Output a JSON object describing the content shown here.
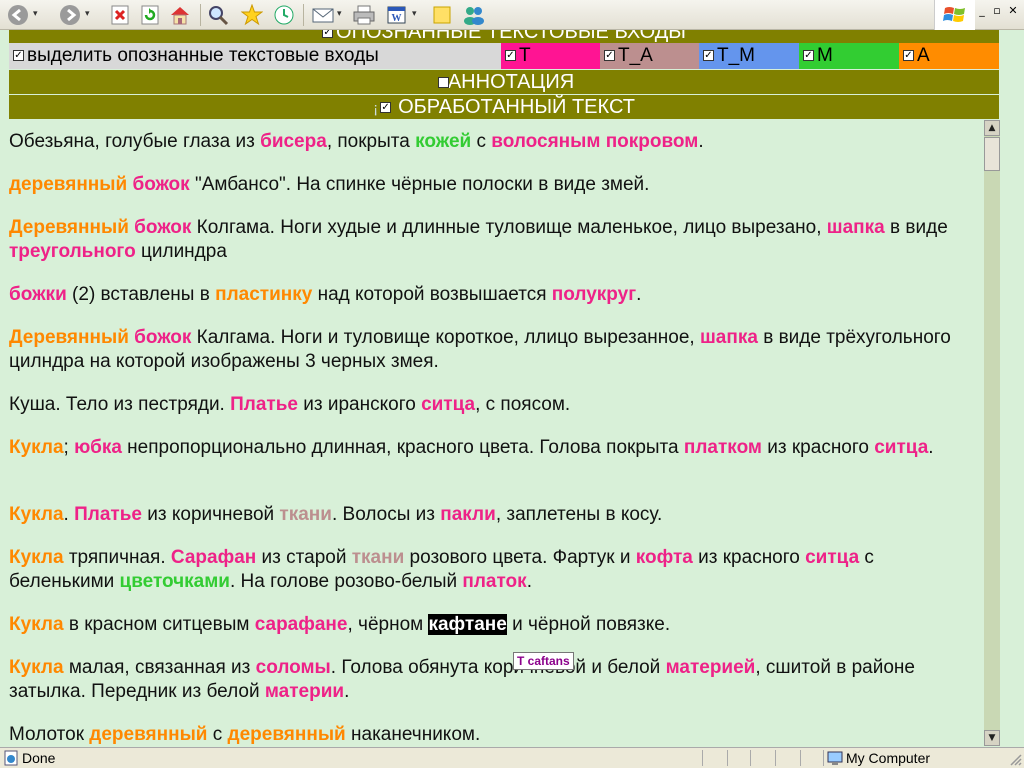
{
  "colors": {
    "pink": "#ee2288",
    "orange": "#ff8800",
    "green": "#33cc33",
    "tan": "#bc8f8f",
    "band": "#808000",
    "content_bg": "#d8f0d8"
  },
  "toolbar": {
    "icons": [
      "back-icon",
      "forward-icon",
      "stop-icon",
      "refresh-icon",
      "home-icon",
      "search-icon",
      "favorites-icon",
      "history-icon",
      "mail-icon",
      "print-icon",
      "edit-icon",
      "discuss-icon",
      "messenger-icon"
    ]
  },
  "panels": {
    "top_band_label": "ОПОЗНАННЫЕ ТЕКСТОВЫЕ ВХОДЫ",
    "filter": {
      "main_label": "выделить опознанные текстовые входы",
      "categories": [
        {
          "label": "T",
          "color": "#ff1493"
        },
        {
          "label": "T_A",
          "color": "#bc8f8f"
        },
        {
          "label": "T_M",
          "color": "#6495ed"
        },
        {
          "label": "M",
          "color": "#32cd32"
        },
        {
          "label": "A",
          "color": "#ff8c00"
        }
      ]
    },
    "annotation_label": "АННОТАЦИЯ",
    "processed_label": "ОБРАБОТАННЫЙ ТЕКСТ",
    "processed_prefix": "¡"
  },
  "paragraphs": [
    [
      [
        "t",
        "Обезьяна, голубые глаза из "
      ],
      [
        "p",
        "бисера"
      ],
      [
        "t",
        ", покрыта "
      ],
      [
        "g",
        "кожей"
      ],
      [
        "t",
        " с "
      ],
      [
        "p",
        "волосяным покровом"
      ],
      [
        "t",
        "."
      ]
    ],
    [
      [
        "o",
        "деревянный"
      ],
      [
        "t",
        " "
      ],
      [
        "p",
        "божок"
      ],
      [
        "t",
        " \"Амбансо\". На спинке чёрные полоски в виде змей."
      ]
    ],
    [
      [
        "o",
        "Деревянный"
      ],
      [
        "t",
        " "
      ],
      [
        "p",
        "божок"
      ],
      [
        "t",
        " Колгама. Ноги худые и длинные туловище маленькое, лицо вырезано, "
      ],
      [
        "p",
        "шапка"
      ],
      [
        "t",
        " в виде "
      ],
      [
        "p",
        "треугольного"
      ],
      [
        "t",
        " цилиндра"
      ]
    ],
    [
      [
        "p",
        "божки"
      ],
      [
        "t",
        " (2) вставлены в "
      ],
      [
        "o",
        "пластинку"
      ],
      [
        "t",
        " над которой возвышается "
      ],
      [
        "p",
        "полукруг"
      ],
      [
        "t",
        "."
      ]
    ],
    [
      [
        "o",
        "Деревянный"
      ],
      [
        "t",
        " "
      ],
      [
        "p",
        "божок"
      ],
      [
        "t",
        " Калгама. Ноги и туловище короткое, ллицо вырезанное, "
      ],
      [
        "p",
        "шапка"
      ],
      [
        "t",
        " в виде трёхугольного цилндра на которой изображены 3 черных змея."
      ]
    ],
    [
      [
        "t",
        "Куша. Тело из пестряди. "
      ],
      [
        "p",
        "Платье"
      ],
      [
        "t",
        " из иранского "
      ],
      [
        "p",
        "ситца"
      ],
      [
        "t",
        ", с поясом."
      ]
    ],
    [
      [
        "o",
        "Кукла"
      ],
      [
        "t",
        "; "
      ],
      [
        "p",
        "юбка"
      ],
      [
        "t",
        " непропорционально длинная, красного цвета. Голова покрыта "
      ],
      [
        "p",
        "платком"
      ],
      [
        "t",
        " из красного "
      ],
      [
        "p",
        "ситца"
      ],
      [
        "t",
        "."
      ]
    ],
    [
      [
        "o",
        "Кукла"
      ],
      [
        "t",
        ". "
      ],
      [
        "p",
        "Платье"
      ],
      [
        "t",
        " из коричневой "
      ],
      [
        "n",
        "ткани"
      ],
      [
        "t",
        ". Волосы из "
      ],
      [
        "p",
        "пакли"
      ],
      [
        "t",
        ", заплетены в косу."
      ]
    ],
    [
      [
        "o",
        "Кукла"
      ],
      [
        "t",
        " тряпичная. "
      ],
      [
        "p",
        "Сарафан"
      ],
      [
        "t",
        " из старой "
      ],
      [
        "n",
        "ткани"
      ],
      [
        "t",
        " розового цвета. Фартук и "
      ],
      [
        "p",
        "кофта"
      ],
      [
        "t",
        " из красного "
      ],
      [
        "p",
        "ситца"
      ],
      [
        "t",
        " с беленькими "
      ],
      [
        "g",
        "цветочками"
      ],
      [
        "t",
        ". На голове розово-белый "
      ],
      [
        "p",
        "платок"
      ],
      [
        "t",
        "."
      ]
    ],
    [
      [
        "o",
        "Кукла"
      ],
      [
        "t",
        " в красном ситцевым "
      ],
      [
        "p",
        "сарафане"
      ],
      [
        "t",
        ", чёрном "
      ],
      [
        "s",
        "кафтане"
      ],
      [
        "t",
        " и чёрной повязке."
      ]
    ],
    [
      [
        "o",
        "Кукла"
      ],
      [
        "t",
        " малая, связанная из "
      ],
      [
        "p",
        "соломы"
      ],
      [
        "t",
        ". Голова обянута коричневой и белой "
      ],
      [
        "p",
        "материей"
      ],
      [
        "t",
        ", сшитой в районе затылка. Передник из белой "
      ],
      [
        "p",
        "материи"
      ],
      [
        "t",
        "."
      ]
    ],
    [
      [
        "t",
        "Молоток "
      ],
      [
        "o",
        "деревянный"
      ],
      [
        "t",
        " с "
      ],
      [
        "o",
        "деревянный"
      ],
      [
        "t",
        " наканечником."
      ]
    ]
  ],
  "tooltip": "T caftans",
  "status": {
    "left": "Done",
    "right": "My Computer"
  }
}
